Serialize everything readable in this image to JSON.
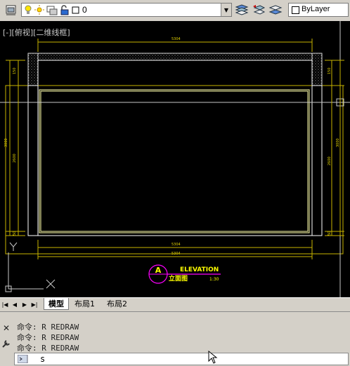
{
  "toolbar": {
    "layer_name": "0",
    "linetype": "ByLayer"
  },
  "viewport": {
    "view_label": "[-][俯视][二维线框]",
    "dims": {
      "top": "5304",
      "bottom1": "5304",
      "bottom2": "5304",
      "left_total": "3000",
      "left_upper": "150",
      "left_mid": "2600",
      "left_low": "50",
      "right_total": "3000",
      "right_upper": "150",
      "right_mid": "2600",
      "right_low": "50"
    },
    "title": {
      "symbol": "A",
      "name": "ELEVATION",
      "subname": "立面图",
      "scale": "1:30"
    },
    "ucs": {
      "y": "Y",
      "x": "X"
    }
  },
  "tabs": {
    "model": "模型",
    "layout1": "布局1",
    "layout2": "布局2"
  },
  "command": {
    "history": [
      "命令: R REDRAW",
      "命令: R REDRAW",
      "命令: R REDRAW"
    ],
    "input_value": "s"
  },
  "colors": {
    "canvas": "#000000",
    "outline": "#ffffff",
    "dimension": "#c8b400",
    "text_yellow": "#ffff00",
    "title_magenta": "#ff00ff"
  }
}
